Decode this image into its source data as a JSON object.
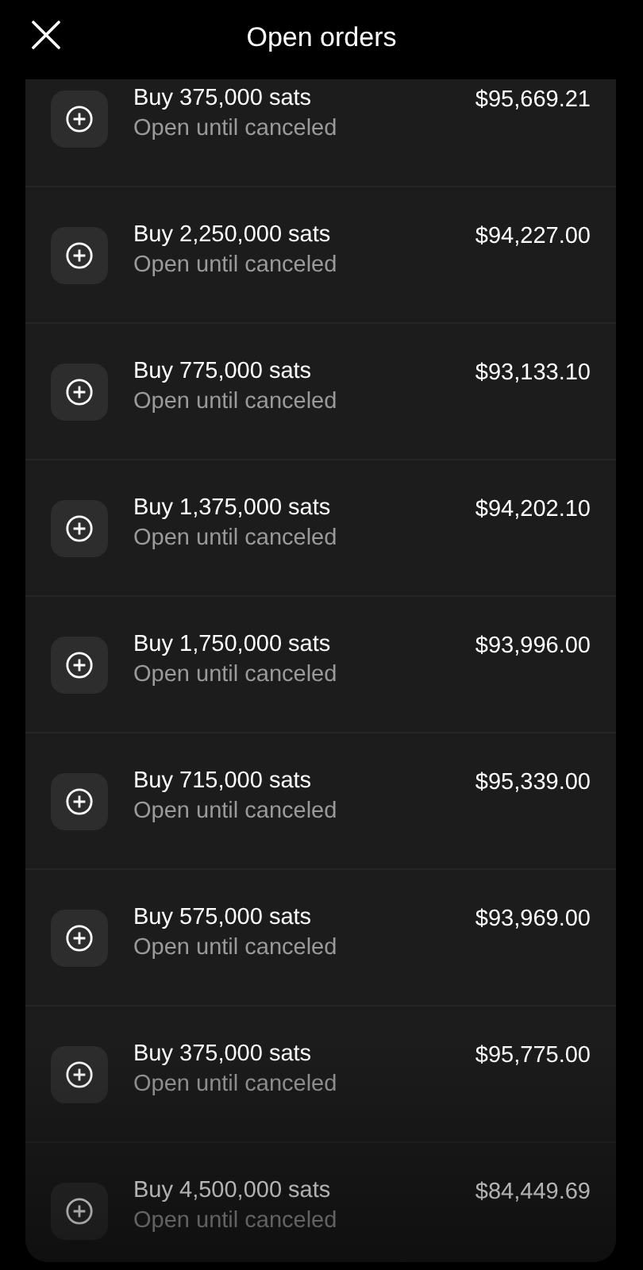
{
  "header": {
    "title": "Open orders"
  },
  "orders": [
    {
      "label": "Buy 375,000 sats",
      "status": "Open until canceled",
      "price": "$95,669.21"
    },
    {
      "label": "Buy 2,250,000 sats",
      "status": "Open until canceled",
      "price": "$94,227.00"
    },
    {
      "label": "Buy 775,000 sats",
      "status": "Open until canceled",
      "price": "$93,133.10"
    },
    {
      "label": "Buy 1,375,000 sats",
      "status": "Open until canceled",
      "price": "$94,202.10"
    },
    {
      "label": "Buy 1,750,000 sats",
      "status": "Open until canceled",
      "price": "$93,996.00"
    },
    {
      "label": "Buy 715,000 sats",
      "status": "Open until canceled",
      "price": "$95,339.00"
    },
    {
      "label": "Buy 575,000 sats",
      "status": "Open until canceled",
      "price": "$93,969.00"
    },
    {
      "label": "Buy 375,000 sats",
      "status": "Open until canceled",
      "price": "$95,775.00"
    },
    {
      "label": "Buy 4,500,000 sats",
      "status": "Open until canceled",
      "price": "$84,449.69"
    }
  ]
}
